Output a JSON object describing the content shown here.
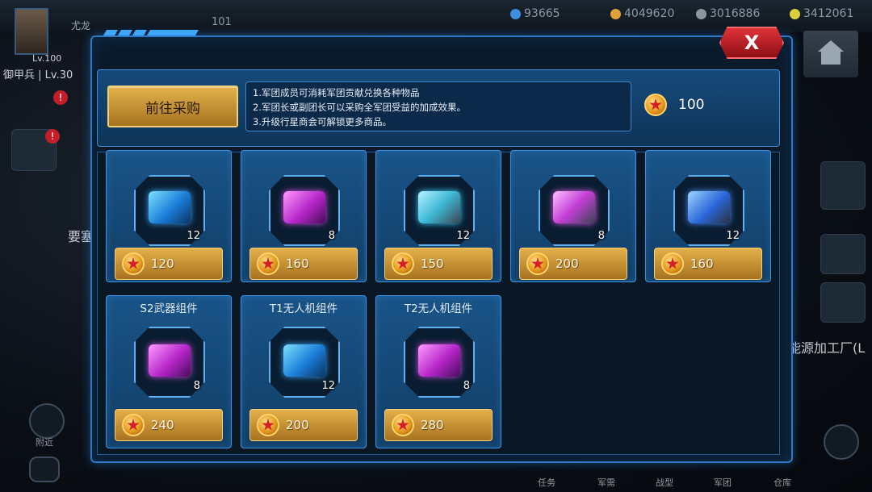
{
  "hud": {
    "player_name": "尤龙",
    "level": "Lv.100",
    "army_info": "御甲兵 | Lv.30",
    "stat_left": "101",
    "resources": [
      {
        "name": "resource-1",
        "value": "93665",
        "color": "#3f8ee0"
      },
      {
        "name": "resource-2",
        "value": "4049620",
        "color": "#e0a23a"
      },
      {
        "name": "resource-3",
        "value": "3016886",
        "color": "#8a96a0"
      },
      {
        "name": "resource-4",
        "value": "3412061",
        "color": "#d8cf3a"
      }
    ],
    "side_text_left": "要塞",
    "side_text_right": "能源加工厂(L",
    "nearby_label": "附近",
    "bottom_tabs": [
      "任务",
      "军需",
      "战型",
      "军团",
      "仓库"
    ]
  },
  "panel": {
    "close_label": "X",
    "purchase_button_label": "前往采购",
    "info_lines": [
      "1.军团成员可消耗军团贡献兑换各种物品",
      "2.军团长或副团长可以采购全军团受益的加成效果。",
      "3.升级行星商会可解锁更多商品。"
    ],
    "balance": "100"
  },
  "items": [
    {
      "title": "",
      "qty": "12",
      "price": "120",
      "art": "blue"
    },
    {
      "title": "",
      "qty": "8",
      "price": "160",
      "art": "purple"
    },
    {
      "title": "",
      "qty": "12",
      "price": "150",
      "art": "tealgun"
    },
    {
      "title": "",
      "qty": "8",
      "price": "200",
      "art": "pinkgun"
    },
    {
      "title": "",
      "qty": "12",
      "price": "160",
      "art": "bluecannon"
    },
    {
      "title": "S2武器组件",
      "qty": "8",
      "price": "240",
      "art": "purple"
    },
    {
      "title": "T1无人机组件",
      "qty": "12",
      "price": "200",
      "art": "blue"
    },
    {
      "title": "T2无人机组件",
      "qty": "8",
      "price": "280",
      "art": "purple"
    }
  ],
  "colors": {
    "panel_border": "#2f79c4",
    "gold": "#e2b24c",
    "close_red": "#e0323a"
  }
}
